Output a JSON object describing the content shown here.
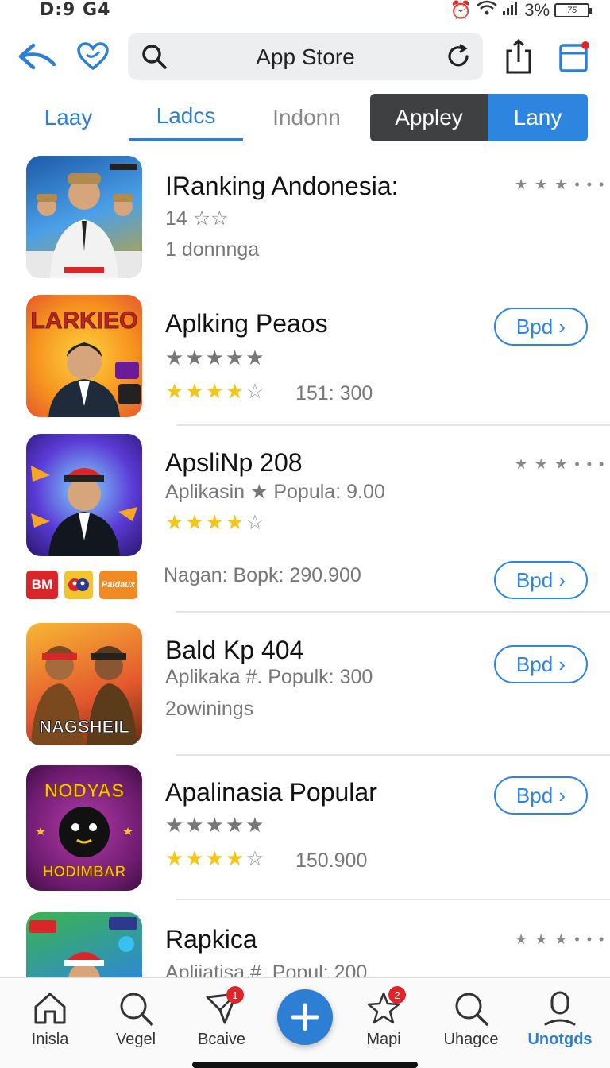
{
  "status": {
    "time": "D:9 G4",
    "battery_pct": "3%",
    "battery_label": "75"
  },
  "search": {
    "text": "App Store"
  },
  "tabs": [
    {
      "label": "Laay"
    },
    {
      "label": "Ladcs",
      "active": true
    },
    {
      "label": "Indonn"
    }
  ],
  "segment": [
    {
      "label": "Appley"
    },
    {
      "label": "Lany",
      "selected": true
    }
  ],
  "apps": [
    {
      "title": "IRanking Andonesia:",
      "line1": "14 ☆☆",
      "line2": "1 donnnga",
      "more": "★ ★ ★ • • •"
    },
    {
      "title": "Aplking Peaos",
      "stars_gray": "★★★★★",
      "rating": 3.5,
      "rating_count": "151: 300",
      "button": "Bpd ›",
      "thumb_text": "LARKIEO"
    },
    {
      "title": "ApsliNp 208",
      "line1": "Aplikasin ★ Popula: 9.00",
      "rating": 3.5,
      "more": "★ ★ ★ • • •",
      "line2": "Nagan: Bopk: 290.900",
      "button": "Bpd ›"
    },
    {
      "title": "Bald Kp 404",
      "line1": "Aplikaka #. Populk: 300",
      "line2": "2owinings",
      "button": "Bpd ›",
      "thumb_text": "NAGSHEIL"
    },
    {
      "title": "Apalinasia Popular",
      "stars_gray": "★★★★★",
      "rating": 3.5,
      "rating_count": "150.900",
      "button": "Bpd ›",
      "thumb_text_top": "NODYAS",
      "thumb_text_bottom": "HODIMBAR"
    },
    {
      "title": "Rapkica",
      "line1": "Apliiatisa #. Popul: 200",
      "more": "★ ★ ★ • • •"
    }
  ],
  "badges": [
    {
      "label": "BM",
      "color": "#d8262b"
    },
    {
      "label": "",
      "color": "#f4c430"
    },
    {
      "label": "Paidaux",
      "color": "#f08a24"
    }
  ],
  "nav": [
    {
      "label": "Inisla",
      "icon": "home-icon"
    },
    {
      "label": "Vegel",
      "icon": "search-icon"
    },
    {
      "label": "Bcaive",
      "icon": "arrow-icon",
      "badge": "1"
    },
    {
      "label": "Mapi",
      "icon": "star-icon",
      "badge": "2"
    },
    {
      "label": "Uhagce",
      "icon": "search-icon"
    },
    {
      "label": "Unotgds",
      "icon": "profile-icon",
      "active": true
    }
  ],
  "colors": {
    "accent": "#2d85e0",
    "segment_dark": "#3e4042",
    "badge_red": "#e0252a",
    "star_gold": "#f5c518"
  }
}
